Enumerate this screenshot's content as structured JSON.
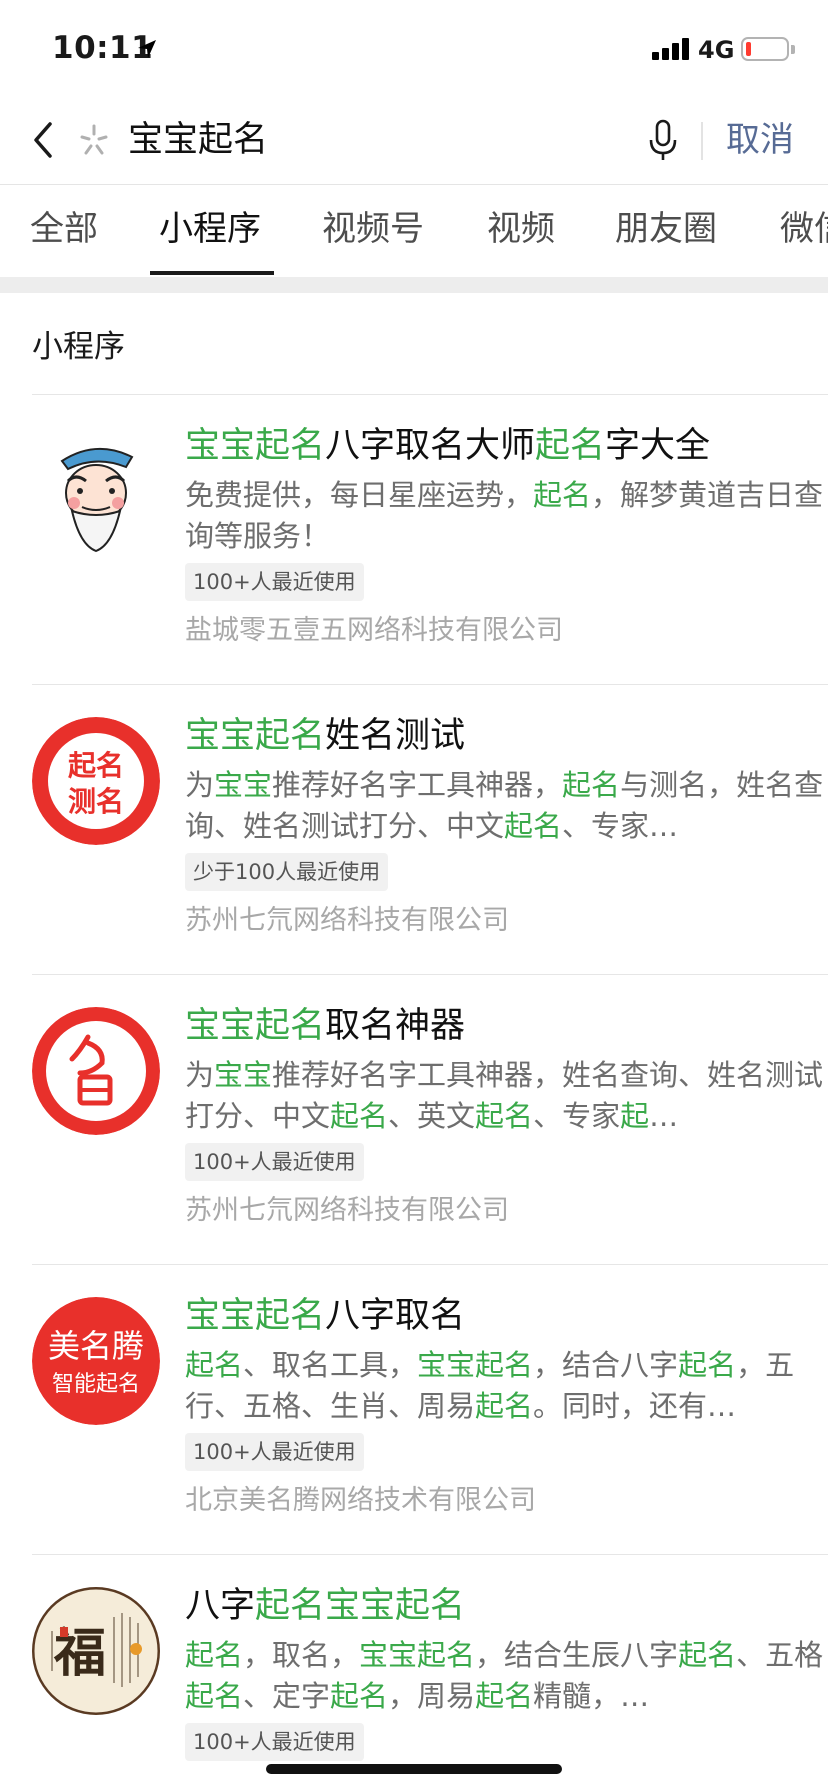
{
  "status_bar": {
    "time": "10:11",
    "network": "4G",
    "battery_level": 0.12,
    "battery_color": "#ff3b30"
  },
  "search": {
    "query": "宝宝起名",
    "cancel_label": "取消",
    "link_color": "#576b95"
  },
  "tabs": [
    {
      "label": "全部",
      "active": false
    },
    {
      "label": "小程序",
      "active": true
    },
    {
      "label": "视频号",
      "active": false
    },
    {
      "label": "视频",
      "active": false
    },
    {
      "label": "朋友圈",
      "active": false
    },
    {
      "label": "微信",
      "active": false
    }
  ],
  "section": {
    "title": "小程序"
  },
  "highlight_color": "#3aa94a",
  "results": [
    {
      "title": [
        [
          "宝宝起名",
          true
        ],
        [
          "八字取名大师",
          false
        ],
        [
          "起名",
          true
        ],
        [
          "字大全",
          false
        ]
      ],
      "desc": [
        [
          "免费提供，每日星座运势，",
          false
        ],
        [
          "起名",
          true
        ],
        [
          "，解梦黄道吉日查询等服务！",
          false
        ]
      ],
      "usage": "100+人最近使用",
      "company": "盐城零五壹五网络科技有限公司",
      "logo_icon": "old-master-cartoon-icon"
    },
    {
      "title": [
        [
          "宝宝起名",
          true
        ],
        [
          "姓名测试",
          false
        ]
      ],
      "desc": [
        [
          "为",
          false
        ],
        [
          "宝宝",
          true
        ],
        [
          "推荐好名字工具神器，",
          false
        ],
        [
          "起名",
          true
        ],
        [
          "与测名，姓名查询、姓名测试打分、中文",
          false
        ],
        [
          "起名",
          true
        ],
        [
          "、专家…",
          false
        ]
      ],
      "usage": "少于100人最近使用",
      "company": "苏州七氘网络科技有限公司",
      "logo_icon": "qiming-ceming-icon",
      "logo_text": [
        "起名",
        "测名"
      ]
    },
    {
      "title": [
        [
          "宝宝起名",
          true
        ],
        [
          "取名神器",
          false
        ]
      ],
      "desc": [
        [
          "为",
          false
        ],
        [
          "宝宝",
          true
        ],
        [
          "推荐好名字工具神器，姓名查询、姓名测试打分、中文",
          false
        ],
        [
          "起名",
          true
        ],
        [
          "、英文",
          false
        ],
        [
          "起名",
          true
        ],
        [
          "、专家",
          false
        ],
        [
          "起",
          true
        ],
        [
          "…",
          false
        ]
      ],
      "usage": "100+人最近使用",
      "company": "苏州七氘网络科技有限公司",
      "logo_icon": "ming-character-icon"
    },
    {
      "title": [
        [
          "宝宝起名",
          true
        ],
        [
          "八字取名",
          false
        ]
      ],
      "desc": [
        [
          "起名",
          true
        ],
        [
          "、取名工具，",
          false
        ],
        [
          "宝宝起名",
          true
        ],
        [
          "，结合八字",
          false
        ],
        [
          "起名",
          true
        ],
        [
          "，五行、五格、生肖、周易",
          false
        ],
        [
          "起名",
          true
        ],
        [
          "。同时，还有…",
          false
        ]
      ],
      "usage": "100+人最近使用",
      "company": "北京美名腾网络技术有限公司",
      "logo_icon": "meimingteng-icon",
      "logo_text": [
        "美名腾",
        "智能起名"
      ]
    },
    {
      "title": [
        [
          "八字",
          false
        ],
        [
          "起名宝宝起名",
          true
        ]
      ],
      "desc": [
        [
          "起名",
          true
        ],
        [
          "，取名，",
          false
        ],
        [
          "宝宝起名",
          true
        ],
        [
          "，结合生辰八字",
          false
        ],
        [
          "起名",
          true
        ],
        [
          "、五格",
          false
        ],
        [
          "起名",
          true
        ],
        [
          "、定字",
          false
        ],
        [
          "起名",
          true
        ],
        [
          "，周易",
          false
        ],
        [
          "起名",
          true
        ],
        [
          "精髓，…",
          false
        ]
      ],
      "usage": "100+人最近使用",
      "company": "",
      "logo_icon": "fu-calligraphy-icon",
      "logo_text": [
        "福"
      ]
    }
  ]
}
